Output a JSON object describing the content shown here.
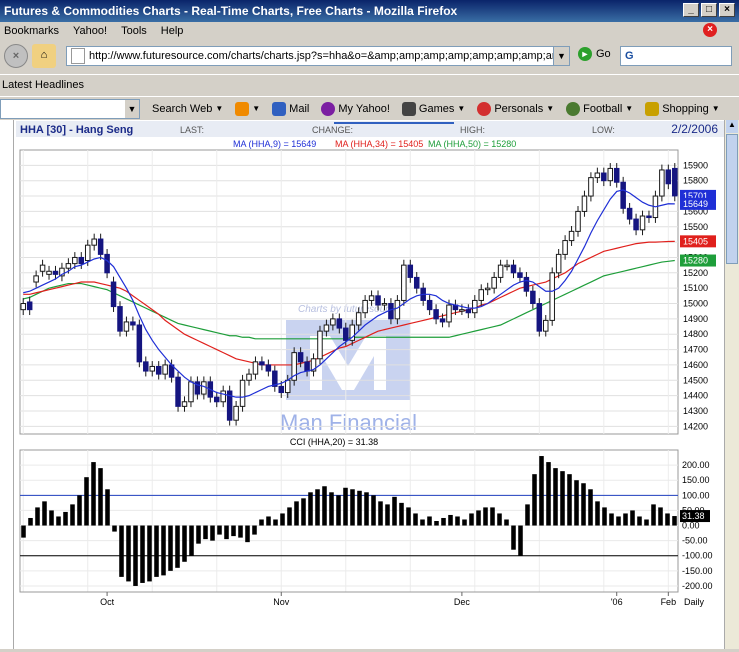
{
  "window": {
    "title": "Futures & Commodities Charts - Real-Time Charts, Free Charts - Mozilla Firefox"
  },
  "menu": [
    "Bookmarks",
    "Yahoo!",
    "Tools",
    "Help"
  ],
  "nav": {
    "url": "http://www.futuresource.com/charts/charts.jsp?s=hha&o=&amp;amp;amp;amp;amp;amp;amp;amp;amp;a=D",
    "go_label": "Go",
    "search_value": "G"
  },
  "bookmarks_bar": {
    "item": "Latest Headlines"
  },
  "yahoo_toolbar": {
    "search_label": "Search Web",
    "items": [
      {
        "label": "Mail",
        "icon": "mail-icon",
        "color": "#3060c0"
      },
      {
        "label": "My Yahoo!",
        "icon": "my-yahoo-icon",
        "color": "#7b1fa2"
      },
      {
        "label": "Games",
        "icon": "games-icon",
        "color": "#444444"
      },
      {
        "label": "Personals",
        "icon": "heart-icon",
        "color": "#d32f2f"
      },
      {
        "label": "Football",
        "icon": "football-icon",
        "color": "#4a7a30"
      },
      {
        "label": "Shopping",
        "icon": "shopping-icon",
        "color": "#c8a000"
      }
    ]
  },
  "chart_header": {
    "symbol": "HHA [30] - Hang Seng",
    "last_label": "LAST:",
    "change_label": "CHANGE:",
    "high_label": "HIGH:",
    "low_label": "LOW:",
    "date": "2/2/2006",
    "ma_legend": [
      {
        "text": "MA (HHA,9) = 15649",
        "color": "#1f2fd6"
      },
      {
        "text": "MA (HHA,34) = 15405",
        "color": "#e0201c"
      },
      {
        "text": "MA (HHA,50) = 15280",
        "color": "#1e9e3a"
      }
    ],
    "watermark_top": "Charts by futuresource",
    "watermark_brand": "Man Financial"
  },
  "cci_header": "CCI (HHA,20) = 31.38",
  "bottom_axis": {
    "months": [
      "Oct",
      "Nov",
      "Dec",
      "'06",
      "Feb"
    ],
    "period": "Daily"
  },
  "chart_data": {
    "type": "candlestick",
    "price_ylim": [
      14150,
      16000
    ],
    "price_ticks": [
      14200,
      14300,
      14400,
      14500,
      14600,
      14700,
      14800,
      14900,
      15000,
      15100,
      15200,
      15300,
      15400,
      15500,
      15600,
      15700,
      15800,
      15900
    ],
    "price_tick_labels": [
      "14200",
      "14300",
      "14400",
      "14500",
      "14600",
      "14700",
      "14800",
      "14900",
      "15000",
      "15100",
      "15200",
      "15300",
      "15400",
      "15500",
      "15600",
      "15700",
      "15800",
      "15900"
    ],
    "last_marker_labels": [
      {
        "value": 15701,
        "text": "15701",
        "color": "#1f2fd6"
      },
      {
        "value": 15649,
        "text": "15649",
        "color": "#1f2fd6"
      },
      {
        "value": 15405,
        "text": "15405",
        "color": "#e0201c"
      },
      {
        "value": 15280,
        "text": "15280",
        "color": "#1e9e3a"
      }
    ],
    "closes": [
      15000,
      14960,
      15180,
      15250,
      15210,
      15190,
      15230,
      15260,
      15300,
      15260,
      15380,
      15420,
      15320,
      15200,
      14980,
      14820,
      14880,
      14860,
      14620,
      14560,
      14590,
      14540,
      14600,
      14520,
      14330,
      14360,
      14490,
      14410,
      14490,
      14390,
      14360,
      14430,
      14240,
      14330,
      14500,
      14540,
      14620,
      14600,
      14560,
      14460,
      14420,
      14500,
      14680,
      14620,
      14560,
      14640,
      14820,
      14860,
      14900,
      14840,
      14760,
      14860,
      14940,
      15020,
      15050,
      14990,
      15000,
      14900,
      15020,
      15250,
      15170,
      15100,
      15020,
      14960,
      14900,
      14880,
      14990,
      14960,
      14960,
      14940,
      15020,
      15090,
      15100,
      15170,
      15250,
      15250,
      15200,
      15170,
      15080,
      15000,
      14820,
      14890,
      15200,
      15320,
      15410,
      15470,
      15600,
      15700,
      15820,
      15850,
      15800,
      15880,
      15790,
      15620,
      15550,
      15480,
      15570,
      15560,
      15700,
      15870,
      15780,
      15701
    ],
    "opens": [
      14960,
      15010,
      15140,
      15210,
      15190,
      15210,
      15180,
      15230,
      15260,
      15300,
      15280,
      15380,
      15420,
      15320,
      15140,
      14980,
      14820,
      14880,
      14860,
      14620,
      14560,
      14590,
      14540,
      14600,
      14520,
      14330,
      14360,
      14490,
      14410,
      14490,
      14390,
      14360,
      14430,
      14240,
      14330,
      14500,
      14540,
      14620,
      14600,
      14560,
      14460,
      14420,
      14500,
      14680,
      14620,
      14560,
      14640,
      14820,
      14860,
      14900,
      14840,
      14760,
      14860,
      14940,
      15020,
      15050,
      14990,
      15000,
      14900,
      15020,
      15250,
      15170,
      15100,
      15020,
      14960,
      14900,
      14880,
      14990,
      14960,
      14960,
      14940,
      15020,
      15090,
      15100,
      15170,
      15250,
      15250,
      15200,
      15170,
      15080,
      15000,
      14820,
      14890,
      15200,
      15320,
      15410,
      15470,
      15600,
      15700,
      15820,
      15850,
      15800,
      15880,
      15790,
      15620,
      15550,
      15480,
      15570,
      15560,
      15700,
      15870,
      15880
    ],
    "ma9": [
      15070,
      15080,
      15100,
      15120,
      15140,
      15160,
      15190,
      15210,
      15240,
      15250,
      15270,
      15290,
      15300,
      15280,
      15240,
      15170,
      15100,
      15020,
      14920,
      14830,
      14760,
      14700,
      14650,
      14600,
      14560,
      14520,
      14490,
      14470,
      14460,
      14440,
      14420,
      14410,
      14400,
      14390,
      14390,
      14400,
      14420,
      14440,
      14460,
      14470,
      14480,
      14500,
      14530,
      14550,
      14560,
      14570,
      14600,
      14640,
      14680,
      14720,
      14750,
      14780,
      14820,
      14860,
      14890,
      14920,
      14940,
      14960,
      14970,
      15000,
      15030,
      15050,
      15060,
      15060,
      15050,
      15020,
      15000,
      14990,
      14980,
      14970,
      14970,
      14980,
      15000,
      15030,
      15060,
      15090,
      15120,
      15140,
      15150,
      15140,
      15110,
      15080,
      15080,
      15100,
      15150,
      15210,
      15290,
      15370,
      15460,
      15540,
      15610,
      15680,
      15730,
      15740,
      15720,
      15690,
      15660,
      15640,
      15630,
      15640,
      15650,
      15649
    ],
    "ma34": [
      15060,
      15060,
      15070,
      15080,
      15090,
      15100,
      15110,
      15120,
      15130,
      15140,
      15140,
      15140,
      15130,
      15120,
      15110,
      15100,
      15080,
      15050,
      15020,
      14990,
      14960,
      14930,
      14890,
      14860,
      14830,
      14800,
      14780,
      14760,
      14740,
      14720,
      14700,
      14680,
      14660,
      14640,
      14630,
      14620,
      14610,
      14600,
      14600,
      14600,
      14600,
      14600,
      14600,
      14610,
      14620,
      14630,
      14650,
      14670,
      14690,
      14710,
      14720,
      14740,
      14760,
      14780,
      14800,
      14820,
      14830,
      14840,
      14850,
      14860,
      14870,
      14880,
      14890,
      14900,
      14910,
      14920,
      14930,
      14940,
      14950,
      14960,
      14970,
      14990,
      15000,
      15020,
      15040,
      15060,
      15080,
      15100,
      15110,
      15120,
      15130,
      15140,
      15160,
      15180,
      15200,
      15230,
      15260,
      15280,
      15300,
      15320,
      15340,
      15350,
      15360,
      15370,
      15380,
      15390,
      15395,
      15400,
      15400,
      15402,
      15404,
      15405
    ],
    "ma50": [
      15030,
      15040,
      15060,
      15080,
      15100,
      15110,
      15120,
      15130,
      15130,
      15130,
      15120,
      15110,
      15100,
      15090,
      15070,
      15050,
      15030,
      15010,
      14990,
      14970,
      14950,
      14930,
      14910,
      14890,
      14870,
      14860,
      14850,
      14840,
      14830,
      14820,
      14810,
      14800,
      14790,
      14790,
      14780,
      14780,
      14770,
      14770,
      14770,
      14770,
      14770,
      14770,
      14770,
      14770,
      14770,
      14770,
      14770,
      14770,
      14770,
      14770,
      14770,
      14780,
      14780,
      14780,
      14780,
      14780,
      14780,
      14780,
      14780,
      14780,
      14780,
      14780,
      14780,
      14780,
      14780,
      14780,
      14780,
      14790,
      14800,
      14810,
      14820,
      14830,
      14840,
      14850,
      14860,
      14880,
      14900,
      14920,
      14940,
      14960,
      14980,
      15000,
      15020,
      15040,
      15060,
      15080,
      15100,
      15120,
      15140,
      15160,
      15180,
      15190,
      15200,
      15210,
      15220,
      15230,
      15240,
      15250,
      15260,
      15270,
      15275,
      15280
    ],
    "cci_ylim": [
      -220,
      250
    ],
    "cci_ticks": [
      200,
      150,
      100,
      50,
      0,
      -50,
      -100,
      -150,
      -200
    ],
    "cci_tick_labels": [
      "200.00",
      "150.00",
      "100.00",
      "50.00",
      "0.00",
      "-50.00",
      "-100.00",
      "-150.00",
      "-200.00"
    ],
    "cci_last": {
      "value": 31.38,
      "text": "31.38"
    },
    "cci_reference_lines": [
      100,
      -100
    ],
    "cci": [
      -40,
      25,
      60,
      80,
      50,
      30,
      45,
      70,
      100,
      160,
      210,
      190,
      120,
      -20,
      -170,
      -185,
      -200,
      -190,
      -185,
      -170,
      -165,
      -150,
      -140,
      -120,
      -100,
      -60,
      -45,
      -50,
      -30,
      -45,
      -35,
      -40,
      -55,
      -30,
      20,
      30,
      20,
      40,
      60,
      80,
      90,
      110,
      120,
      130,
      110,
      100,
      125,
      120,
      115,
      110,
      100,
      80,
      70,
      95,
      75,
      60,
      40,
      20,
      30,
      15,
      25,
      35,
      30,
      20,
      40,
      50,
      60,
      60,
      40,
      20,
      -80,
      -100,
      70,
      170,
      230,
      210,
      190,
      180,
      170,
      150,
      140,
      120,
      80,
      60,
      40,
      30,
      40,
      50,
      30,
      20,
      70,
      60,
      40,
      31.38
    ]
  }
}
